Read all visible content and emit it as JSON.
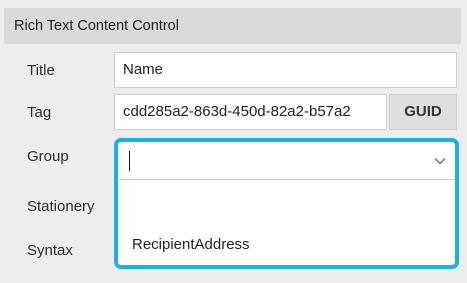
{
  "panel": {
    "header_title": "Rich Text Content Control"
  },
  "fields": {
    "title_label": "Title",
    "title_value": "Name",
    "tag_label": "Tag",
    "tag_value": "cdd285a2-863d-450d-82a2-b57a2",
    "guid_button": "GUID",
    "group_label": "Group",
    "group_value": "",
    "stationery_label": "Stationery",
    "syntax_label": "Syntax"
  },
  "group_dropdown": {
    "options": [
      "",
      "RecipientAddress"
    ]
  },
  "colors": {
    "focus_border": "#1ab1e6",
    "panel_bg": "#ededed",
    "header_bg": "#d9d9d9"
  }
}
